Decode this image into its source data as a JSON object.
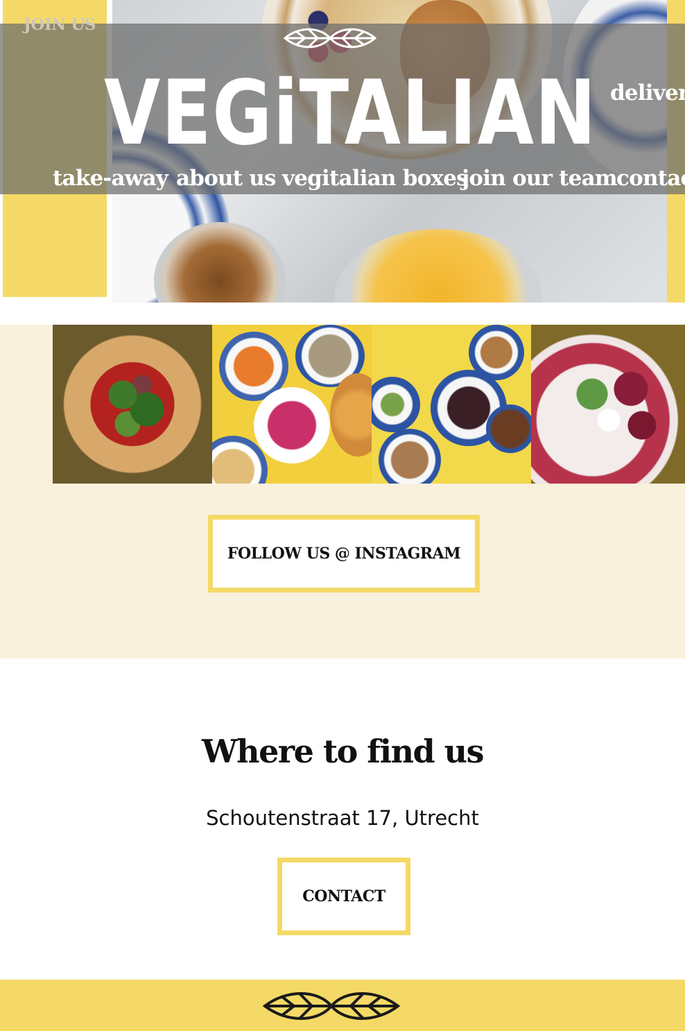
{
  "header": {
    "join_us": "JOIN US",
    "logo_text": "VEGiTALIAN"
  },
  "nav": {
    "delivery": "delivery",
    "takeaway": "take-away",
    "about": "about us",
    "boxes": "vegitalian boxes",
    "join_team": "join our team",
    "contact": "contact"
  },
  "instagram": {
    "button_label": "FOLLOW US @ INSTAGRAM"
  },
  "find_us": {
    "title": "Where to find us",
    "address": "Schoutenstraat 17, Utrecht",
    "contact_button": "CONTACT"
  },
  "colors": {
    "accent_yellow": "#f4d966",
    "cream_background": "#f9f1dc",
    "text_dark": "#111111",
    "nav_overlay": "rgba(108,108,108,0.72)"
  },
  "icons": {
    "logo_leaf": "double-leaf-icon",
    "footer_leaf": "double-leaf-icon"
  }
}
